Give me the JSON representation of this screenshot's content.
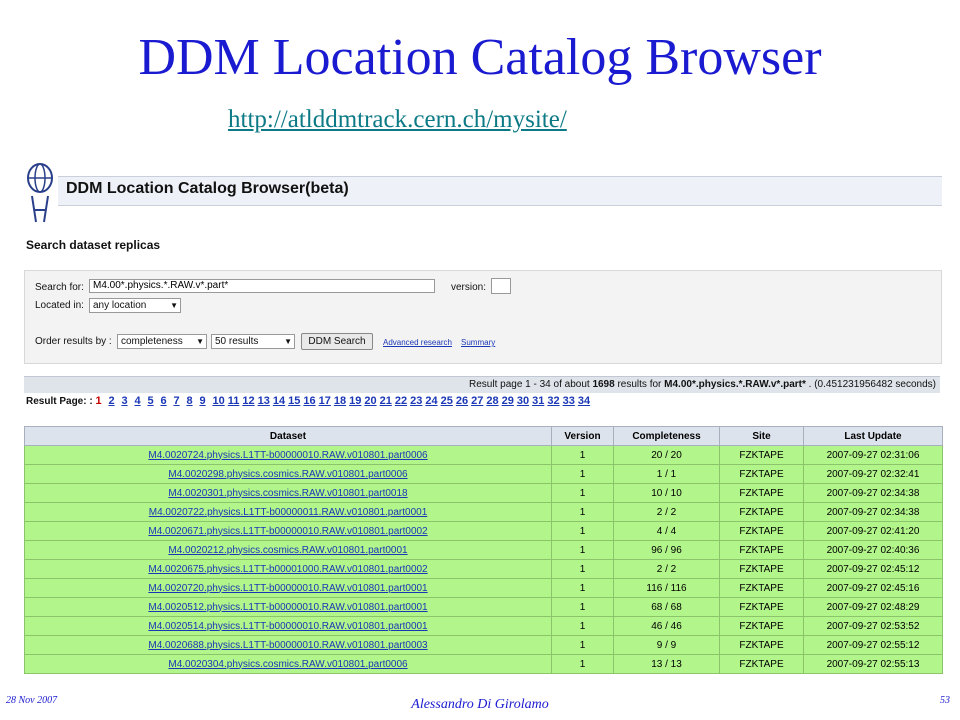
{
  "slide": {
    "title": "DDM Location Catalog Browser",
    "url": "http://atlddmtrack.cern.ch/mysite/",
    "footer_date": "28 Nov 2007",
    "footer_author": "Alessandro Di Girolamo",
    "footer_page": "53"
  },
  "app": {
    "header_title": "DDM Location Catalog Browser(beta)",
    "search_heading": "Search dataset replicas"
  },
  "search": {
    "search_for_label": "Search for:",
    "search_for_value": "M4.00*.physics.*.RAW.v*.part*",
    "version_label": "version:",
    "version_value": "",
    "located_in_label": "Located in:",
    "located_in_value": "any location",
    "order_label": "Order results by :",
    "order_value": "completeness",
    "results_value": "50 results",
    "search_button": "DDM Search",
    "advanced_link": "Advanced research",
    "summary_link": "Summary"
  },
  "results": {
    "summary_prefix": "Result page 1 - 34 of about ",
    "summary_count": "1698",
    "summary_mid": " results for ",
    "summary_query": "M4.00*.physics.*.RAW.v*.part*",
    "summary_suffix": " . (0.451231956482 seconds)",
    "page_label": "Result Page: :",
    "pages": [
      "1",
      "2",
      "3",
      "4",
      "5",
      "6",
      "7",
      "8",
      "9",
      "10",
      "11",
      "12",
      "13",
      "14",
      "15",
      "16",
      "17",
      "18",
      "19",
      "20",
      "21",
      "22",
      "23",
      "24",
      "25",
      "26",
      "27",
      "28",
      "29",
      "30",
      "31",
      "32",
      "33",
      "34"
    ]
  },
  "table": {
    "headers": [
      "Dataset",
      "Version",
      "Completeness",
      "Site",
      "Last Update"
    ],
    "rows": [
      {
        "dataset": "M4.0020724.physics.L1TT-b00000010.RAW.v010801.part0006",
        "version": "1",
        "completeness": "20 / 20",
        "site": "FZKTAPE",
        "updated": "2007-09-27 02:31:06"
      },
      {
        "dataset": "M4.0020298.physics.cosmics.RAW.v010801.part0006",
        "version": "1",
        "completeness": "1 / 1",
        "site": "FZKTAPE",
        "updated": "2007-09-27 02:32:41"
      },
      {
        "dataset": "M4.0020301.physics.cosmics.RAW.v010801.part0018",
        "version": "1",
        "completeness": "10 / 10",
        "site": "FZKTAPE",
        "updated": "2007-09-27 02:34:38"
      },
      {
        "dataset": "M4.0020722.physics.L1TT-b00000011.RAW.v010801.part0001",
        "version": "1",
        "completeness": "2 / 2",
        "site": "FZKTAPE",
        "updated": "2007-09-27 02:34:38"
      },
      {
        "dataset": "M4.0020671.physics.L1TT-b00000010.RAW.v010801.part0002",
        "version": "1",
        "completeness": "4 / 4",
        "site": "FZKTAPE",
        "updated": "2007-09-27 02:41:20"
      },
      {
        "dataset": "M4.0020212.physics.cosmics.RAW.v010801.part0001",
        "version": "1",
        "completeness": "96 / 96",
        "site": "FZKTAPE",
        "updated": "2007-09-27 02:40:36"
      },
      {
        "dataset": "M4.0020675.physics.L1TT-b00001000.RAW.v010801.part0002",
        "version": "1",
        "completeness": "2 / 2",
        "site": "FZKTAPE",
        "updated": "2007-09-27 02:45:12"
      },
      {
        "dataset": "M4.0020720.physics.L1TT-b00000010.RAW.v010801.part0001",
        "version": "1",
        "completeness": "116 / 116",
        "site": "FZKTAPE",
        "updated": "2007-09-27 02:45:16"
      },
      {
        "dataset": "M4.0020512.physics.L1TT-b00000010.RAW.v010801.part0001",
        "version": "1",
        "completeness": "68 / 68",
        "site": "FZKTAPE",
        "updated": "2007-09-27 02:48:29"
      },
      {
        "dataset": "M4.0020514.physics.L1TT-b00000010.RAW.v010801.part0001",
        "version": "1",
        "completeness": "46 / 46",
        "site": "FZKTAPE",
        "updated": "2007-09-27 02:53:52"
      },
      {
        "dataset": "M4.0020688.physics.L1TT-b00000010.RAW.v010801.part0003",
        "version": "1",
        "completeness": "9 / 9",
        "site": "FZKTAPE",
        "updated": "2007-09-27 02:55:12"
      },
      {
        "dataset": "M4.0020304.physics.cosmics.RAW.v010801.part0006",
        "version": "1",
        "completeness": "13 / 13",
        "site": "FZKTAPE",
        "updated": "2007-09-27 02:55:13"
      }
    ]
  },
  "colors": {
    "title": "#1a1ad0",
    "url": "#0c7a86",
    "row_bg": "#b2f58a",
    "link": "#1a37b6",
    "current_page": "#c80000"
  }
}
